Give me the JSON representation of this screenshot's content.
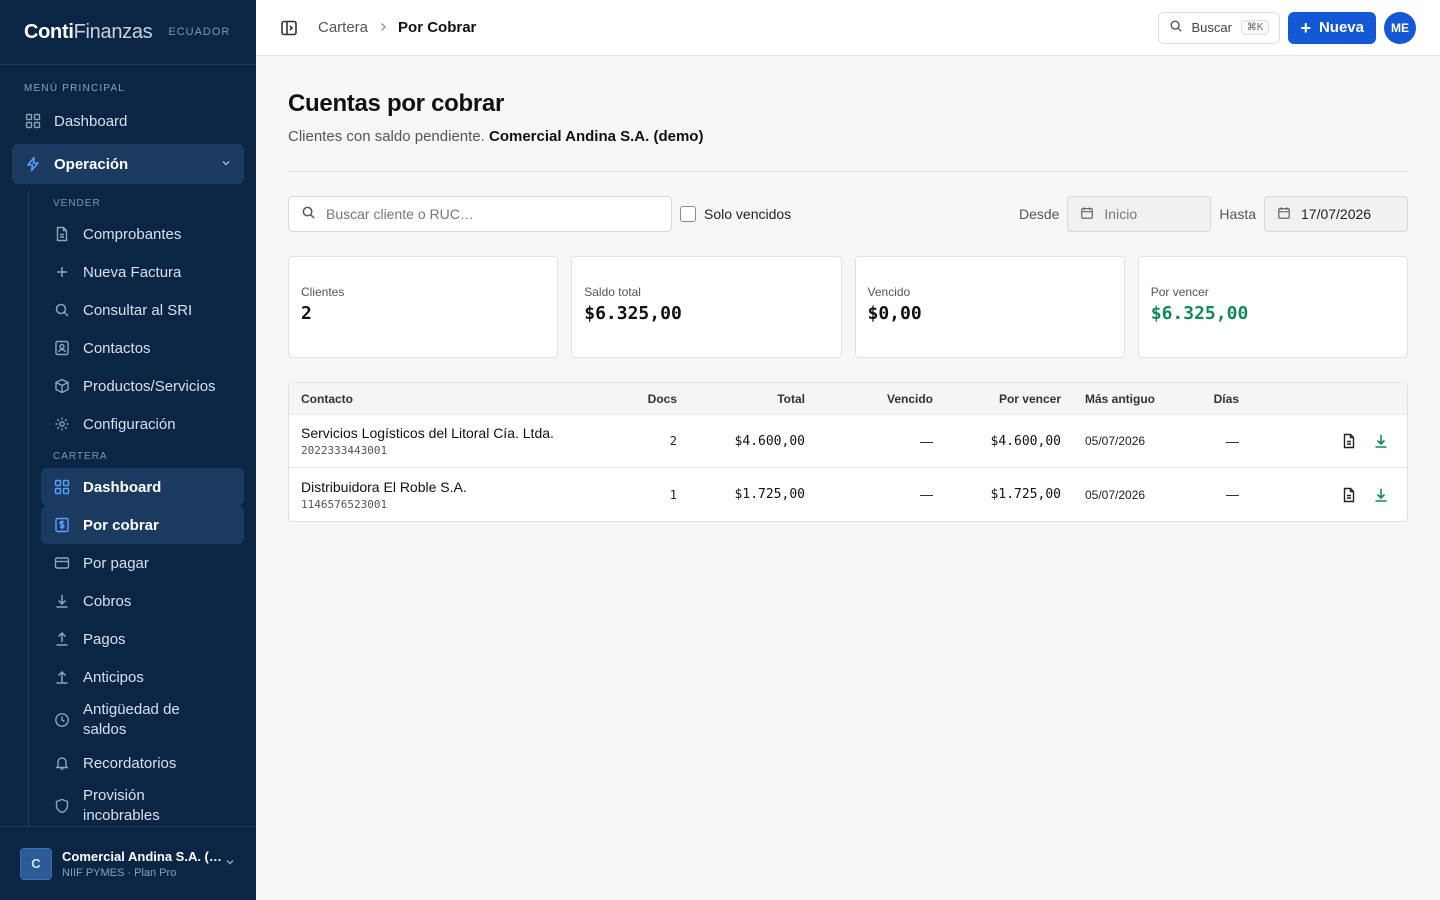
{
  "sidebar": {
    "brand_strong": "Conti",
    "brand_light": "Finanzas",
    "region": "ECUADOR",
    "main_menu_label": "MENÚ PRINCIPAL",
    "dashboard": "Dashboard",
    "operation_group": "Operación",
    "sell_label": "VENDER",
    "sell_items": [
      "Comprobantes",
      "Nueva Factura",
      "Consultar al SRI",
      "Contactos",
      "Productos/Servicios",
      "Configuración"
    ],
    "portfolio_label": "CARTERA",
    "portfolio_items": [
      "Dashboard",
      "Por cobrar",
      "Por pagar",
      "Cobros",
      "Pagos",
      "Anticipos",
      "Antigüedad de saldos",
      "Recordatorios",
      "Provisión incobrables"
    ],
    "org_initial": "C",
    "org_name": "Comercial Andina S.A. (demo)",
    "org_plan": "NIIF PYMES · Plan Pro"
  },
  "topbar": {
    "crumb_parent": "Cartera",
    "crumb_current": "Por Cobrar",
    "search_label": "Buscar",
    "search_shortcut": "⌘K",
    "new_label": "Nueva",
    "user_initials": "ME"
  },
  "page": {
    "title": "Cuentas por cobrar",
    "subtitle_prefix": "Clientes con saldo pendiente.",
    "company": "Comercial Andina S.A. (demo)"
  },
  "filters": {
    "search_placeholder": "Buscar cliente o RUC…",
    "overdue_only": "Solo vencidos",
    "from_label": "Desde",
    "from_value": "Inicio",
    "to_label": "Hasta",
    "to_value": "17/07/2026"
  },
  "summary": [
    {
      "label": "Clientes",
      "value": "2"
    },
    {
      "label": "Saldo total",
      "value": "$6.325,00"
    },
    {
      "label": "Vencido",
      "value": "$0,00"
    },
    {
      "label": "Por vencer",
      "value": "$6.325,00"
    }
  ],
  "table": {
    "headers": [
      "Contacto",
      "Docs",
      "Total",
      "Vencido",
      "Por vencer",
      "Más antiguo",
      "Días"
    ],
    "rows": [
      {
        "name": "Servicios Logísticos del Litoral Cía. Ltda.",
        "ruc": "2022333443001",
        "docs": "2",
        "total": "$4.600,00",
        "overdue": "—",
        "pending": "$4.600,00",
        "oldest": "05/07/2026",
        "days": "—"
      },
      {
        "name": "Distribuidora El Roble S.A.",
        "ruc": "1146576523001",
        "docs": "1",
        "total": "$1.725,00",
        "overdue": "—",
        "pending": "$1.725,00",
        "oldest": "05/07/2026",
        "days": "—"
      }
    ]
  },
  "colors": {
    "sidebar_bg": "#0b2545",
    "primary": "#1458d6",
    "positive": "#0f8a56"
  }
}
